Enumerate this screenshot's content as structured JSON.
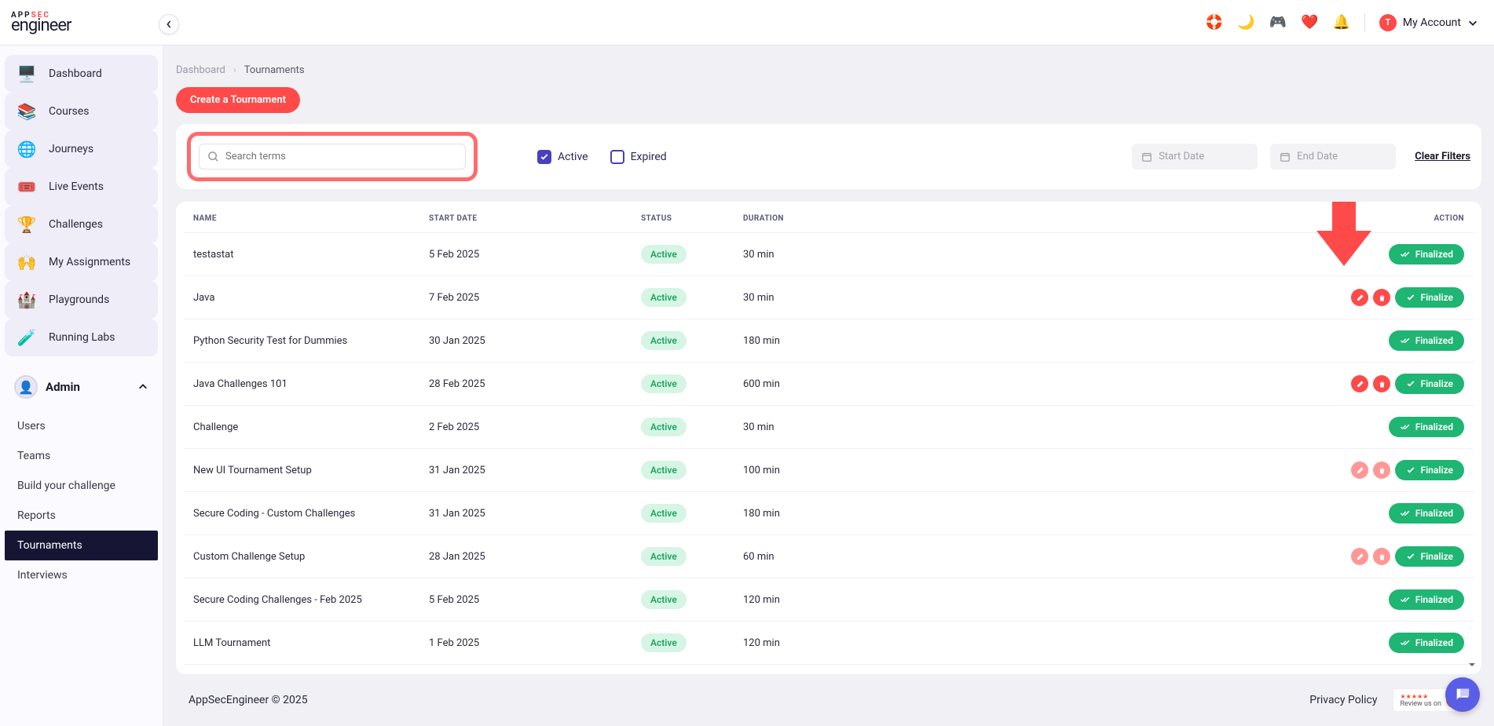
{
  "brand": {
    "app": "APP",
    "sec": "SEC",
    "engineer": "engineer"
  },
  "account": {
    "initial": "T",
    "label": "My Account"
  },
  "sidebar": {
    "items": [
      {
        "label": "Dashboard",
        "icon": "🖥️"
      },
      {
        "label": "Courses",
        "icon": "📚"
      },
      {
        "label": "Journeys",
        "icon": "🌐"
      },
      {
        "label": "Live Events",
        "icon": "🎟️"
      },
      {
        "label": "Challenges",
        "icon": "🏆"
      },
      {
        "label": "My Assignments",
        "icon": "🙌"
      },
      {
        "label": "Playgrounds",
        "icon": "🏰"
      },
      {
        "label": "Running Labs",
        "icon": "🧪"
      }
    ],
    "admin": {
      "title": "Admin",
      "items": [
        {
          "label": "Users",
          "active": false
        },
        {
          "label": "Teams",
          "active": false
        },
        {
          "label": "Build your challenge",
          "active": false
        },
        {
          "label": "Reports",
          "active": false
        },
        {
          "label": "Tournaments",
          "active": true
        },
        {
          "label": "Interviews",
          "active": false
        }
      ]
    }
  },
  "breadcrumb": {
    "root": "Dashboard",
    "current": "Tournaments"
  },
  "buttons": {
    "create": "Create a Tournament",
    "clearFilters": "Clear Filters",
    "finalized": "Finalized",
    "finalize": "Finalize"
  },
  "filters": {
    "searchPlaceholder": "Search terms",
    "active": "Active",
    "expired": "Expired",
    "startDate": "Start Date",
    "endDate": "End Date"
  },
  "table": {
    "headers": {
      "name": "NAME",
      "start": "START DATE",
      "status": "STATUS",
      "duration": "DURATION",
      "action": "ACTION"
    },
    "rows": [
      {
        "name": "testastat",
        "start": "5 Feb 2025",
        "status": "Active",
        "duration": "30 min",
        "state": "finalized"
      },
      {
        "name": "Java",
        "start": "7 Feb 2025",
        "status": "Active",
        "duration": "30 min",
        "state": "finalize",
        "editDelete": true
      },
      {
        "name": "Python Security Test for Dummies",
        "start": "30 Jan 2025",
        "status": "Active",
        "duration": "180 min",
        "state": "finalized"
      },
      {
        "name": "Java Challenges 101",
        "start": "28 Feb 2025",
        "status": "Active",
        "duration": "600 min",
        "state": "finalize",
        "editDelete": true
      },
      {
        "name": "Challenge",
        "start": "2 Feb 2025",
        "status": "Active",
        "duration": "30 min",
        "state": "finalized"
      },
      {
        "name": "New UI Tournament Setup",
        "start": "31 Jan 2025",
        "status": "Active",
        "duration": "100 min",
        "state": "finalize",
        "editDelete": true,
        "faded": true
      },
      {
        "name": "Secure Coding - Custom Challenges",
        "start": "31 Jan 2025",
        "status": "Active",
        "duration": "180 min",
        "state": "finalized"
      },
      {
        "name": "Custom Challenge Setup",
        "start": "28 Jan 2025",
        "status": "Active",
        "duration": "60 min",
        "state": "finalize",
        "editDelete": true,
        "faded": true
      },
      {
        "name": "Secure Coding Challenges - Feb 2025",
        "start": "5 Feb 2025",
        "status": "Active",
        "duration": "120 min",
        "state": "finalized"
      },
      {
        "name": "LLM Tournament",
        "start": "1 Feb 2025",
        "status": "Active",
        "duration": "120 min",
        "state": "finalized"
      }
    ]
  },
  "footer": {
    "copyright": "AppSecEngineer © 2025",
    "privacy": "Privacy Policy",
    "g2": "Review us on",
    "stars": "★★★★★"
  }
}
